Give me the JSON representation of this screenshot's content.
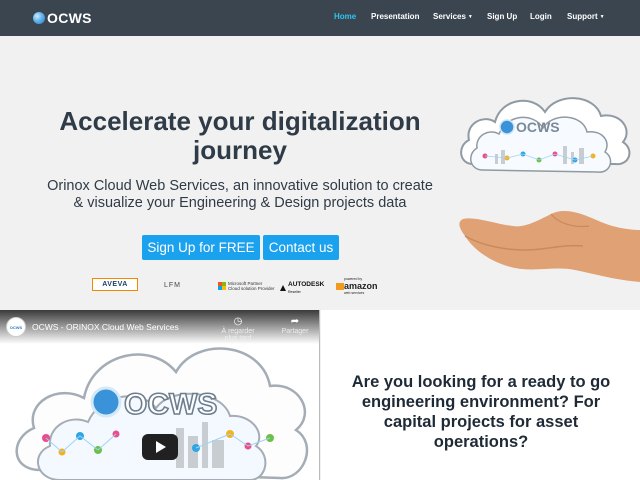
{
  "navbar": {
    "brand": "OCWS",
    "items": [
      {
        "label": "Home",
        "active": true
      },
      {
        "label": "Presentation"
      },
      {
        "label": "Services",
        "dropdown": true
      },
      {
        "label": "Sign Up"
      },
      {
        "label": "Login"
      },
      {
        "label": "Support",
        "dropdown": true
      }
    ]
  },
  "hero": {
    "title": "Accelerate your digitalization journey",
    "subtitle": "Orinox Cloud Web Services, an innovative solution to create & visualize your Engineering & Design projects data",
    "signup_button": "Sign Up for FREE",
    "contact_button": "Contact us",
    "art_brand": "OCWS"
  },
  "partners": {
    "aveva": "AVEVA",
    "lfm": "LFM",
    "microsoft": "Microsoft Partner",
    "microsoft_sub": "Cloud solution Provider",
    "autodesk": "AUTODESK",
    "autodesk_sub": "Reseller",
    "amazon_small": "powered by",
    "amazon": "amazon",
    "amazon_sub": "web services"
  },
  "video": {
    "channel": "OCWS",
    "title": "OCWS - ORINOX Cloud Web Services",
    "watch_later": "À regarder plus tard",
    "share": "Partager",
    "thumb_brand": "OCWS"
  },
  "question": "Are you looking for a ready to go engineering environment? For capital projects for asset operations?",
  "colors": {
    "navbar": "#3b4550",
    "accent": "#1ba2ee",
    "active_nav": "#2ec4f3",
    "heading": "#2f3b47"
  }
}
